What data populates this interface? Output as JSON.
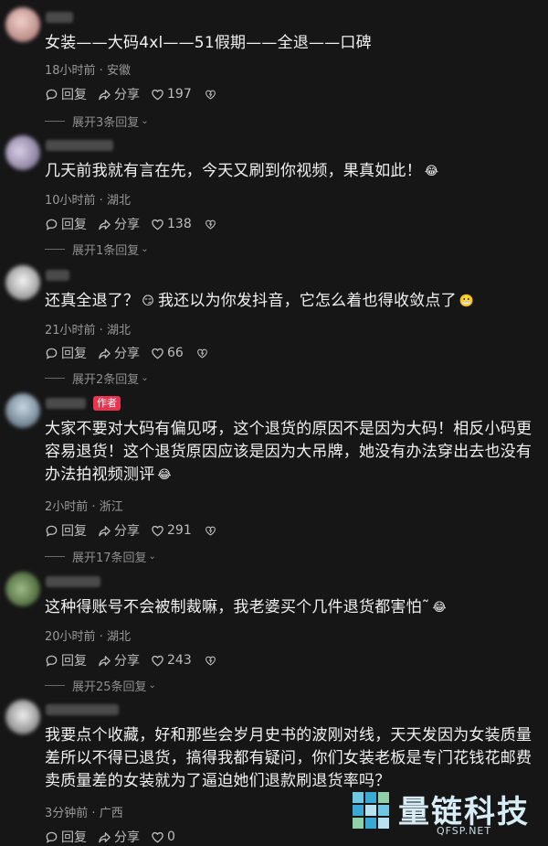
{
  "comments": [
    {
      "text": "女装——大码4xl——51假期——全退——口碑",
      "time": "18小时前",
      "location": "安徽",
      "reply_label": "回复",
      "share_label": "分享",
      "likes": "197",
      "expand_label": "展开3条回复"
    },
    {
      "text": "几天前我就有言在先，今天又刷到你视频，果真如此！",
      "time": "10小时前",
      "location": "湖北",
      "reply_label": "回复",
      "share_label": "分享",
      "likes": "138",
      "expand_label": "展开1条回复"
    },
    {
      "text_a": "还真全退了？",
      "text_b": "我还以为你发抖音，它怎么着也得收敛点了",
      "time": "21小时前",
      "location": "湖北",
      "reply_label": "回复",
      "share_label": "分享",
      "likes": "66",
      "expand_label": "展开2条回复"
    },
    {
      "author_tag": "作者",
      "text": "大家不要对大码有偏见呀，这个退货的原因不是因为大码！相反小码更容易退货！这个退货原因应该是因为大吊牌，她没有办法穿出去也没有办法拍视频测评",
      "time": "2小时前",
      "location": "浙江",
      "reply_label": "回复",
      "share_label": "分享",
      "likes": "291",
      "expand_label": "展开17条回复"
    },
    {
      "text": "这种得账号不会被制裁嘛，我老婆买个几件退货都害怕˜",
      "time": "20小时前",
      "location": "湖北",
      "reply_label": "回复",
      "share_label": "分享",
      "likes": "243",
      "expand_label": "展开25条回复"
    },
    {
      "text": "我要点个收藏，好和那些会岁月史书的波刚对线，天天发因为女装质量差所以不得已退货，搞得我都有疑问，你们女装老板是专门花钱花邮费卖质量差的女装就为了逼迫她们退款刷退货率吗？",
      "time": "3分钟前",
      "location": "广西",
      "reply_label": "回复",
      "share_label": "分享",
      "likes": "0"
    }
  ],
  "meta_separator": " · ",
  "watermark": {
    "name": "量链科技",
    "url": "QFSP.NET"
  },
  "colors": {
    "background": "#161616",
    "author_tag": "#e8344f",
    "watermark": "#d7ecf4"
  },
  "icons": [
    "comment-icon",
    "share-icon",
    "heart-icon",
    "dislike-icon",
    "chevron-down-icon",
    "laugh-cry-emoji",
    "smirk-emoji",
    "grin-emoji"
  ]
}
